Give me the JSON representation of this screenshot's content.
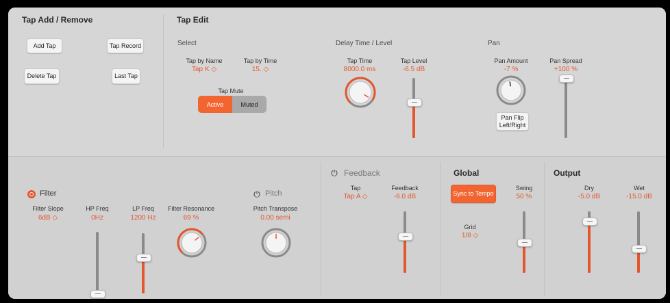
{
  "tap_add_remove": {
    "title": "Tap Add / Remove",
    "add_tap": "Add Tap",
    "tap_record": "Tap Record",
    "delete_tap": "Delete Tap",
    "last_tap": "Last Tap"
  },
  "tap_edit": {
    "title": "Tap Edit",
    "select_heading": "Select",
    "tap_by_name_label": "Tap by Name",
    "tap_by_name_value": "Tap K ◇",
    "tap_by_time_label": "Tap by Time",
    "tap_by_time_value": "15. ◇",
    "tap_mute_label": "Tap Mute",
    "tap_mute_options": [
      "Active",
      "Muted"
    ],
    "tap_mute_selected": "Active",
    "delay_heading": "Delay Time / Level",
    "tap_time_label": "Tap Time",
    "tap_time_value": "8000.0 ms",
    "tap_level_label": "Tap Level",
    "tap_level_value": "-6.5 dB",
    "pan_heading": "Pan",
    "pan_amount_label": "Pan Amount",
    "pan_amount_value": "-7 %",
    "pan_flip_label": "Pan Flip Left/Right",
    "pan_spread_label": "Pan Spread",
    "pan_spread_value": "+100 %"
  },
  "filter": {
    "title": "Filter",
    "slope_label": "Filter Slope",
    "slope_value": "6dB ◇",
    "hp_label": "HP Freq",
    "hp_value": "0Hz",
    "lp_label": "LP Freq",
    "lp_value": "1200 Hz",
    "res_label": "Filter Resonance",
    "res_value": "69 %"
  },
  "pitch": {
    "title": "Pitch",
    "transpose_label": "Pitch Transpose",
    "transpose_value": "0.00 semi"
  },
  "feedback": {
    "title": "Feedback",
    "tap_label": "Tap",
    "tap_value": "Tap A ◇",
    "feedback_label": "Feedback",
    "feedback_value": "-6.0 dB"
  },
  "global": {
    "title": "Global",
    "sync_label": "Sync to Tempo",
    "swing_label": "Swing",
    "swing_value": "50 %",
    "grid_label": "Grid",
    "grid_value": "1/8 ◇"
  },
  "output": {
    "title": "Output",
    "dry_label": "Dry",
    "dry_value": "-5.0 dB",
    "wet_label": "Wet",
    "wet_value": "-15.0 dB"
  },
  "levels": {
    "tap_level": 0.6,
    "pan_spread": 1.0,
    "hp_freq": 0.0,
    "lp_freq": 0.6,
    "feedback": 0.6,
    "swing": 0.5,
    "dry": 0.85,
    "wet": 0.4,
    "tap_time_knob": 0.95,
    "pan_amount_knob": 0.47,
    "resonance_knob": 0.69,
    "pitch_knob": 0.5
  },
  "colors": {
    "accent": "#e4572e",
    "panel": "#d6d6d6"
  }
}
